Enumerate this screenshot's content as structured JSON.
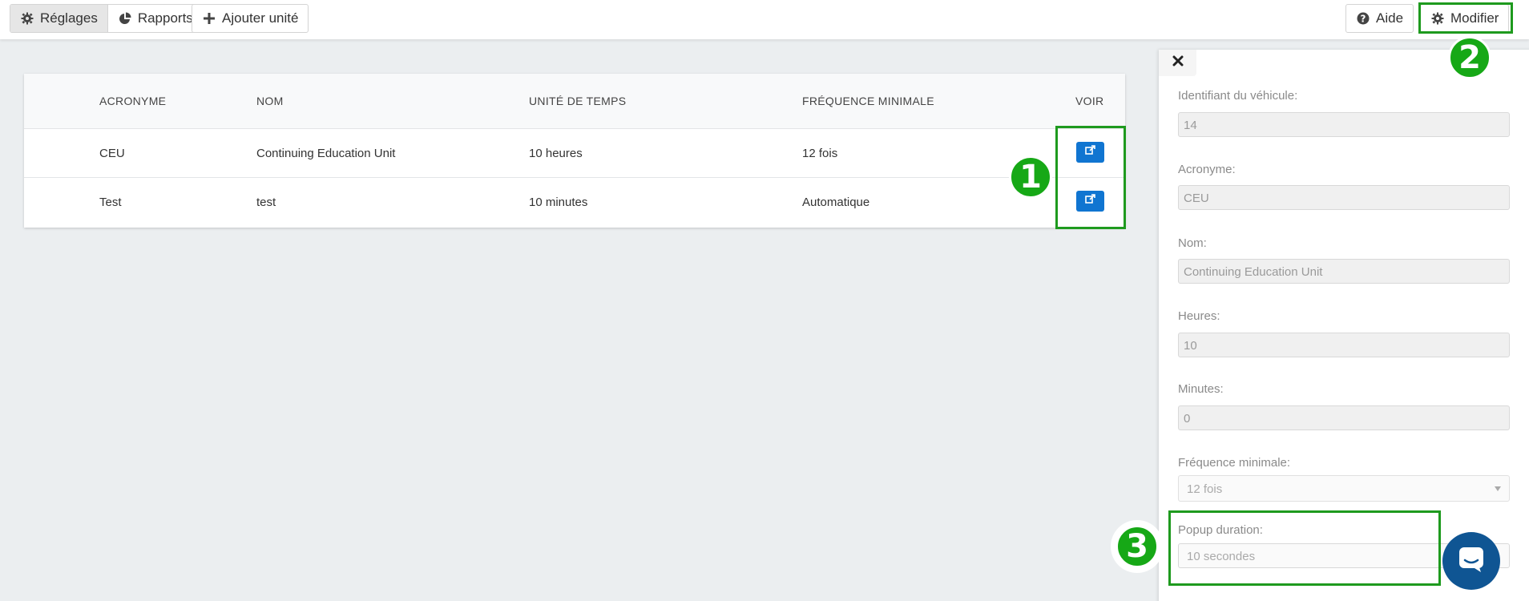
{
  "toolbar": {
    "settings_label": "Réglages",
    "reports_label": "Rapports",
    "add_unit_label": "Ajouter unité",
    "help_label": "Aide",
    "edit_label": "Modifier"
  },
  "table": {
    "headers": [
      "ACRONYME",
      "NOM",
      "UNITÉ DE TEMPS",
      "FRÉQUENCE MINIMALE",
      "VOIR"
    ],
    "rows": [
      {
        "acronym": "CEU",
        "name": "Continuing Education Unit",
        "time_unit": "10 heures",
        "min_frequency": "12 fois"
      },
      {
        "acronym": "Test",
        "name": "test",
        "time_unit": "10 minutes",
        "min_frequency": "Automatique"
      }
    ]
  },
  "panel": {
    "vehicle_id": {
      "label": "Identifiant du véhicule:",
      "value": "14"
    },
    "acronym": {
      "label": "Acronyme:",
      "value": "CEU"
    },
    "name": {
      "label": "Nom:",
      "value": "Continuing Education Unit"
    },
    "hours": {
      "label": "Heures:",
      "value": "10"
    },
    "minutes": {
      "label": "Minutes:",
      "value": "0"
    },
    "min_frequency": {
      "label": "Fréquence minimale:",
      "value": "12 fois"
    },
    "popup_duration": {
      "label": "Popup duration:",
      "value": "10 secondes"
    }
  },
  "annotations": {
    "badge_1": "1",
    "badge_2": "2",
    "badge_3": "3",
    "highlight_color": "#1e9a1e",
    "badge_color": "#16a816"
  },
  "colors": {
    "primary_button": "#1075d1",
    "chat_bubble": "#0f5593"
  },
  "icons": {
    "settings": "gear-icon",
    "reports": "pie-chart-icon",
    "add": "plus-icon",
    "help": "question-circle-icon",
    "edit": "gear-icon",
    "view": "external-link-icon",
    "close": "close-icon",
    "chat": "chat-icon"
  }
}
